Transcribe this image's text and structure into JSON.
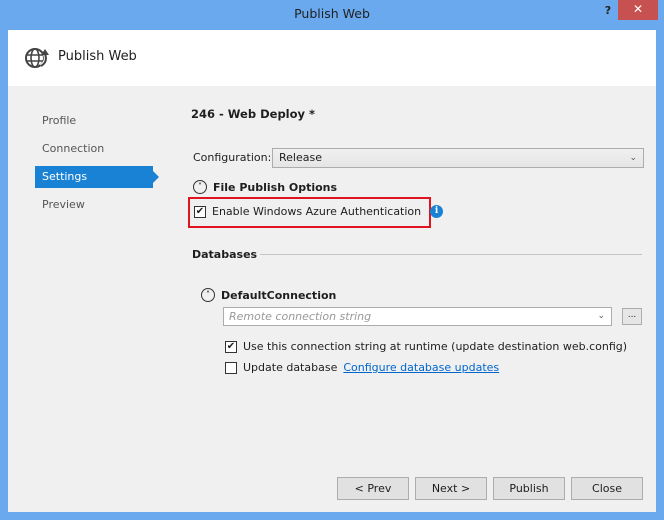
{
  "window": {
    "title": "Publish Web",
    "help_label": "?",
    "close_label": "✕"
  },
  "header": {
    "title": "Publish Web",
    "icon": "globe-publish-icon"
  },
  "nav": {
    "items": [
      {
        "label": "Profile",
        "active": false
      },
      {
        "label": "Connection",
        "active": false
      },
      {
        "label": "Settings",
        "active": true
      },
      {
        "label": "Preview",
        "active": false
      }
    ]
  },
  "main": {
    "profile_title": "246 - Web Deploy *",
    "configuration": {
      "label": "Configuration:",
      "value": "Release"
    },
    "file_publish": {
      "heading": "File Publish Options",
      "expander": "˅",
      "azure_auth": {
        "label": "Enable Windows Azure Authentication",
        "checked": true,
        "info": "i"
      }
    },
    "databases": {
      "heading": "Databases",
      "connection": {
        "name": "DefaultConnection",
        "expander": "˄",
        "placeholder": "Remote connection string",
        "browse_label": "...",
        "use_runtime": {
          "label": "Use this connection string at runtime (update destination web.config)",
          "checked": true
        },
        "update_db": {
          "label": "Update database",
          "checked": false,
          "link": "Configure database updates"
        }
      }
    }
  },
  "footer": {
    "prev": "< Prev",
    "next": "Next >",
    "publish": "Publish",
    "close": "Close"
  },
  "colors": {
    "accent": "#1a82d4",
    "frame": "#6aa9ee",
    "close": "#c75050",
    "highlight": "#e0141e"
  }
}
